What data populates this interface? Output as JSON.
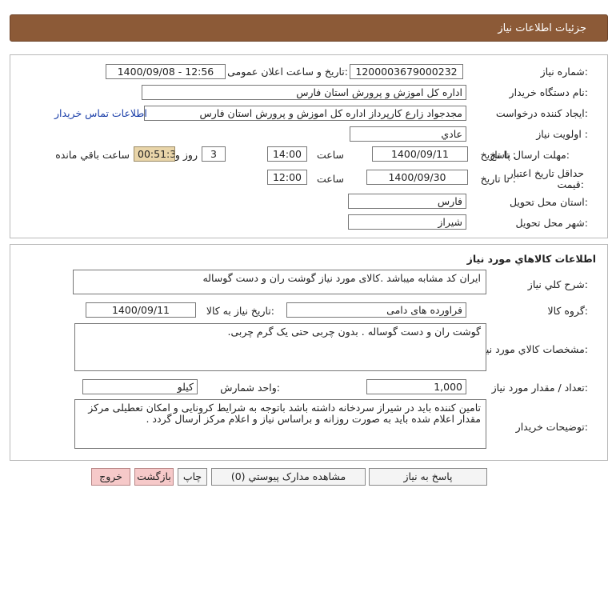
{
  "header": {
    "title": "جزئیات اطلاعات نیاز"
  },
  "need_info": {
    "need_number_label": "شماره نیاز:",
    "need_number": "1200003679000232",
    "announce_label": "تاریخ و ساعت اعلان عمومی:",
    "announce_value": "1400/09/08 - 12:56",
    "buyer_org_label": "نام دستگاه خریدار:",
    "buyer_org": "اداره کل اموزش و پرورش استان فارس",
    "creator_label": "ایجاد کننده درخواست:",
    "creator": "مجدجواد زارع کارپرداز اداره کل اموزش و پرورش استان فارس",
    "contact_link": "اطلاعات تماس خریدار",
    "priority_label": "اولویت نیاز :",
    "priority": "عادي",
    "reply_deadline_label": "مهلت ارسال پاسخ:",
    "to_date_label": "تا تاریخ :",
    "reply_date": "1400/09/11",
    "time_label": "ساعت",
    "reply_time": "14:00",
    "days": "3",
    "days_label": "روز و",
    "remaining": "00:51:34",
    "remaining_label": "ساعت باقي مانده",
    "validity_label_1": "حداقل تاریخ اعتبار",
    "validity_label_2": "قیمت:",
    "validity_to_label": "تا تاریخ :",
    "validity_date": "1400/09/30",
    "validity_time_label": "ساعت",
    "validity_time": "12:00",
    "province_label": "استان محل تحویل:",
    "province": "فارس",
    "city_label": "شهر محل تحویل:",
    "city": "شیراز"
  },
  "goods_info": {
    "section_title": "اطلاعات کالاهاي مورد نياز",
    "general_desc_label": "شرح کلي نياز:",
    "general_desc": "ایران کد مشابه میباشد .کالای مورد نیاز گوشت ران و دست گوساله",
    "group_label": "گروه کالا:",
    "group": "فراورده های دامی",
    "need_date_label": "تاریخ نیاز به کالا:",
    "need_date": "1400/09/11",
    "specs_label": "مشخصات کالاي مورد نياز:",
    "specs": "گوشت ران و دست گوساله . بدون چربی حتی یک گرم چربی.",
    "quantity_label": "تعداد / مقدار مورد نیاز:",
    "quantity": "1,000",
    "unit_label": "واحد شمارش:",
    "unit": "کیلو",
    "buyer_notes_label": "توضیحات خریدار:",
    "buyer_notes": "تامین کننده باید در شیراز سردخانه داشته باشد باتوجه به شرایط کرونایی و امکان تعطیلی مرکز مقدار اعلام شده باید به صورت روزانه و براساس نیاز و اعلام مرکز ارسال گردد ."
  },
  "buttons": {
    "reply": "پاسخ به نیاز",
    "attachments": "مشاهده مدارک پیوستي (0)",
    "print": "چاپ",
    "back": "بازگشت",
    "exit": "خروج"
  }
}
